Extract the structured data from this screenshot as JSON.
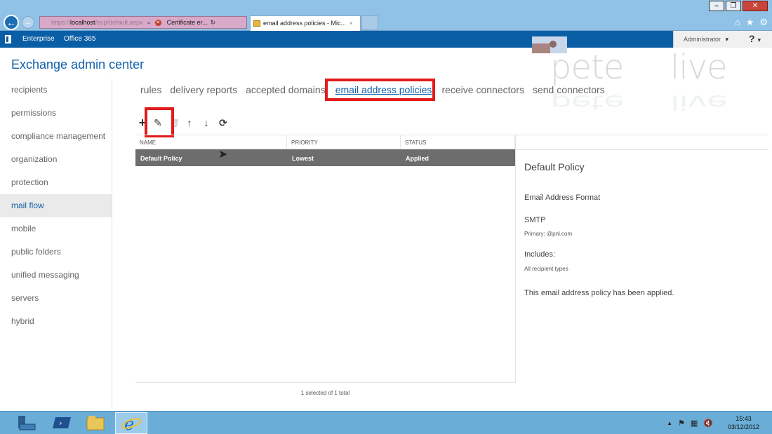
{
  "browser": {
    "address_host": "localhost",
    "address_rest": "/ecp/default.aspx",
    "address_prefix": "https://",
    "cert_error": "Certificate er...",
    "tab_title": "email address policies - Mic...",
    "tab_close": "×"
  },
  "o365": {
    "enterprise": "Enterprise",
    "office365": "Office 365",
    "admin": "Administrator",
    "admin_caret": "▾",
    "help": "?",
    "help_caret": "▾"
  },
  "brand": {
    "word1": "pete",
    "word2": "live"
  },
  "page": {
    "title": "Exchange admin center"
  },
  "nav": {
    "items": [
      {
        "label": "recipients"
      },
      {
        "label": "permissions"
      },
      {
        "label": "compliance management"
      },
      {
        "label": "organization"
      },
      {
        "label": "protection"
      },
      {
        "label": "mail flow"
      },
      {
        "label": "mobile"
      },
      {
        "label": "public folders"
      },
      {
        "label": "unified messaging"
      },
      {
        "label": "servers"
      },
      {
        "label": "hybrid"
      }
    ],
    "active_index": 5
  },
  "subnav": {
    "items": [
      {
        "label": "rules"
      },
      {
        "label": "delivery reports"
      },
      {
        "label": "accepted domains"
      },
      {
        "label": "email address policies"
      },
      {
        "label": "receive connectors"
      },
      {
        "label": "send connectors"
      }
    ],
    "active_index": 3
  },
  "toolbar": {
    "add": "+",
    "edit": "✎",
    "delete": "🗑",
    "up": "↑",
    "down": "↓",
    "refresh": "⟳"
  },
  "table": {
    "headers": [
      "NAME",
      "PRIORITY",
      "STATUS"
    ],
    "rows": [
      {
        "name": "Default Policy",
        "priority": "Lowest",
        "status": "Applied"
      }
    ],
    "footer": "1 selected of 1 total"
  },
  "detail": {
    "title": "Default Policy",
    "format_label": "Email Address Format",
    "smtp_label": "SMTP",
    "smtp_value": "Primary: @pnl.com",
    "includes_label": "Includes:",
    "includes_value": "All recipient types",
    "status_text": "This email address policy has been applied."
  },
  "taskbar": {
    "time": "15:43",
    "date": "03/12/2012"
  },
  "colors": {
    "accent": "#1160a8",
    "highlight": "#e21b1b",
    "o365_bar": "#0a5ea6"
  }
}
